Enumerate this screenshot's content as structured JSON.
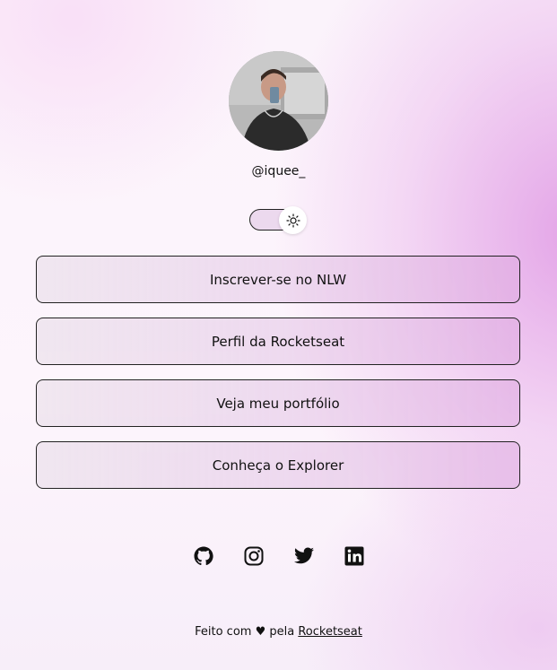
{
  "profile": {
    "username": "@iquee_"
  },
  "theme_toggle": {
    "state": "light",
    "icon": "sun-icon"
  },
  "links": [
    {
      "label": "Inscrever-se no NLW"
    },
    {
      "label": "Perfil da Rocketseat"
    },
    {
      "label": "Veja meu portfólio"
    },
    {
      "label": "Conheça o Explorer"
    }
  ],
  "social": [
    {
      "name": "github-icon"
    },
    {
      "name": "instagram-icon"
    },
    {
      "name": "twitter-icon"
    },
    {
      "name": "linkedin-icon"
    }
  ],
  "footer": {
    "prefix": "Feito com ♥ pela",
    "link": "Rocketseat"
  },
  "colors": {
    "accent": "#e6a8e8",
    "text": "#111111",
    "border": "#222222"
  }
}
